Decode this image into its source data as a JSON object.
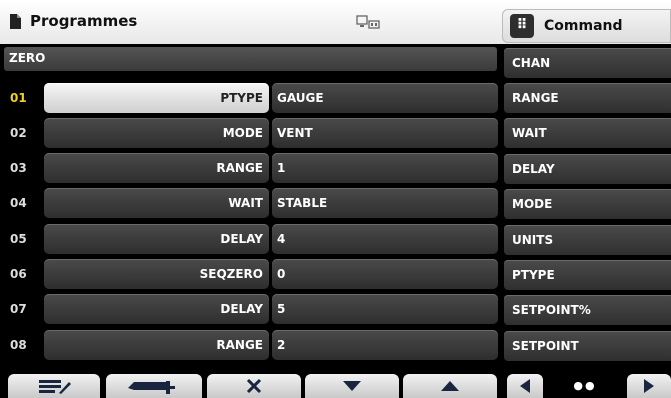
{
  "header": {
    "title": "Programmes",
    "command_label": "Command",
    "command_grip": "⠿",
    "icons": {
      "doc": "document-icon",
      "status": "remote-connection-icon"
    }
  },
  "program": {
    "name": "ZERO",
    "selected_row": "01",
    "rows": [
      {
        "num": "01",
        "key": "PTYPE",
        "value": "GAUGE"
      },
      {
        "num": "02",
        "key": "MODE",
        "value": "VENT"
      },
      {
        "num": "03",
        "key": "RANGE",
        "value": "1"
      },
      {
        "num": "04",
        "key": "WAIT",
        "value": "STABLE"
      },
      {
        "num": "05",
        "key": "DELAY",
        "value": "4"
      },
      {
        "num": "06",
        "key": "SEQZERO",
        "value": "0"
      },
      {
        "num": "07",
        "key": "DELAY",
        "value": "5"
      },
      {
        "num": "08",
        "key": "RANGE",
        "value": "2"
      }
    ]
  },
  "commands": [
    "CHAN",
    "RANGE",
    "WAIT",
    "DELAY",
    "MODE",
    "UNITS",
    "PTYPE",
    "SETPOINT%",
    "SETPOINT"
  ],
  "toolbar": {
    "buttons": [
      "edit-list-icon",
      "insert-row-icon",
      "delete-x-icon",
      "down-arrow-icon",
      "up-arrow-icon",
      "prev-page-icon",
      "page-dots-icon",
      "next-page-icon"
    ],
    "page_dots": "●●"
  },
  "colors": {
    "selected_number": "#f0d020",
    "background": "#000000"
  }
}
